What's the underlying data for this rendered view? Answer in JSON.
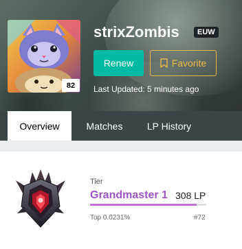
{
  "profile": {
    "level": "82",
    "name": "strixZombis",
    "region": "EUW",
    "last_updated": "Last Updated: 5 minutes ago"
  },
  "actions": {
    "renew_label": "Renew",
    "favorite_label": "Favorite"
  },
  "tabs": [
    {
      "label": "Overview",
      "active": true
    },
    {
      "label": "Matches",
      "active": false
    },
    {
      "label": "LP History",
      "active": false
    }
  ],
  "tier": {
    "label": "Tier",
    "name": "Grandmaster 1",
    "lp": "308 LP",
    "top_percent": "Top 0.0231%",
    "rank": "#72",
    "progress_fraction": 0.92
  },
  "colors": {
    "renew": "#00bba3",
    "favorite": "#e8b84a",
    "tier_name": "#9e54c7",
    "progress": "#c26fd6"
  },
  "icons": {
    "profile": "cat-profile-icon",
    "favorite": "bookmark-icon",
    "tier": "grandmaster-emblem-icon"
  }
}
